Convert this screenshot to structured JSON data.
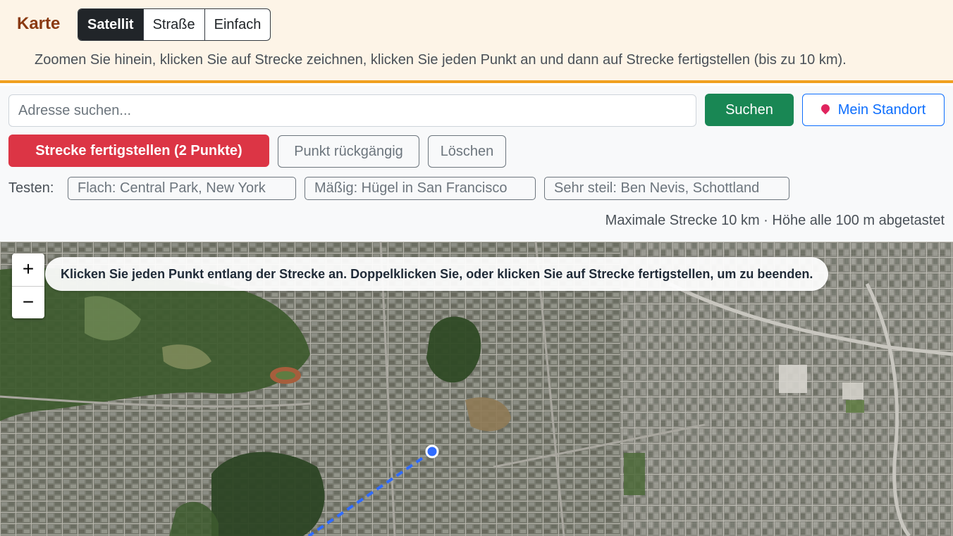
{
  "header": {
    "brand": "Karte",
    "map_types": [
      {
        "label": "Satellit",
        "active": true
      },
      {
        "label": "Straße",
        "active": false
      },
      {
        "label": "Einfach",
        "active": false
      }
    ],
    "hint": "Zoomen Sie hinein, klicken Sie auf Strecke zeichnen, klicken Sie jeden Punkt an und dann auf Strecke fertigstellen (bis zu 10 km)."
  },
  "search": {
    "placeholder": "Adresse suchen...",
    "value": "",
    "search_label": "Suchen",
    "location_label": "Mein Standort",
    "location_icon": "map-pin-icon"
  },
  "actions": {
    "finish_label": "Strecke fertigstellen (2 Punkte)",
    "undo_label": "Punkt rückgängig",
    "clear_label": "Löschen"
  },
  "tests": {
    "label": "Testen:",
    "items": [
      "Flach: Central Park, New York",
      "Mäßig: Hügel in San Francisco",
      "Sehr steil: Ben Nevis, Schottland"
    ]
  },
  "max_info": "Maximale Strecke 10 km · Höhe alle 100 m abgetastet",
  "map": {
    "zoom_in": "+",
    "zoom_out": "−",
    "tooltip": "Klicken Sie jeden Punkt entlang der Strecke an. Doppelklicken Sie, oder klicken Sie auf Strecke fertigstellen, um zu beenden.",
    "route_color": "#2f6bff",
    "route_points": 2
  },
  "colors": {
    "accent": "#f0a020",
    "brand": "#8a3a12",
    "finish": "#dc3545",
    "search": "#198754",
    "location": "#0d6efd"
  }
}
